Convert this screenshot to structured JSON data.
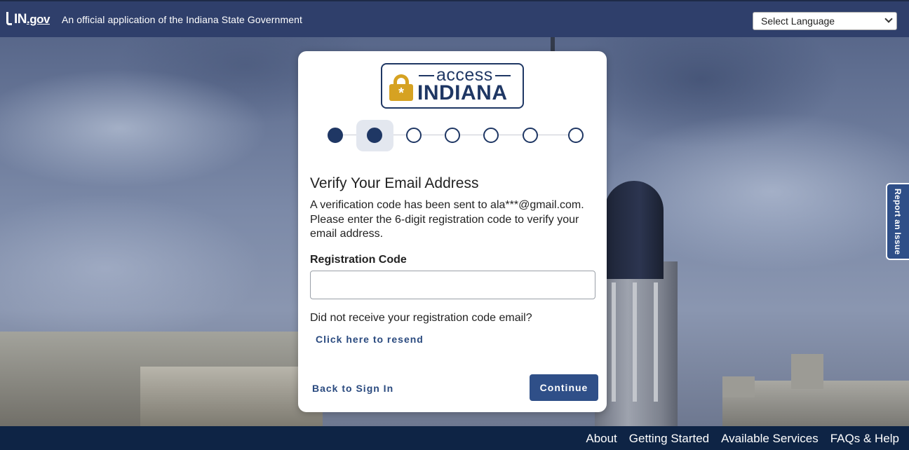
{
  "header": {
    "logo_text": "IN",
    "logo_suffix": ".gov",
    "tagline": "An official application of the Indiana State Government",
    "language_select": "Select Language"
  },
  "brand": {
    "access": "access",
    "indiana": "INDIANA"
  },
  "stepper": {
    "total": 7,
    "completed": 2,
    "current": 2
  },
  "form": {
    "title": "Verify Your Email Address",
    "description": "A verification code has been sent to ala***@gmail.com. Please enter the 6-digit registration code to verify your email address.",
    "field_label": "Registration Code",
    "field_value": "",
    "no_receive_text": "Did not receive your registration code email?",
    "resend_link": "Click here to resend",
    "back_link": "Back to Sign In",
    "continue_button": "Continue"
  },
  "report_tab": "Report an Issue",
  "footer": {
    "links": [
      "About",
      "Getting Started",
      "Available Services",
      "FAQs & Help"
    ]
  },
  "colors": {
    "header_bg": "#2f3f6b",
    "footer_bg": "#0e2445",
    "brand_navy": "#1f3764",
    "brand_gold": "#d6a222",
    "button_bg": "#2f4f88"
  }
}
